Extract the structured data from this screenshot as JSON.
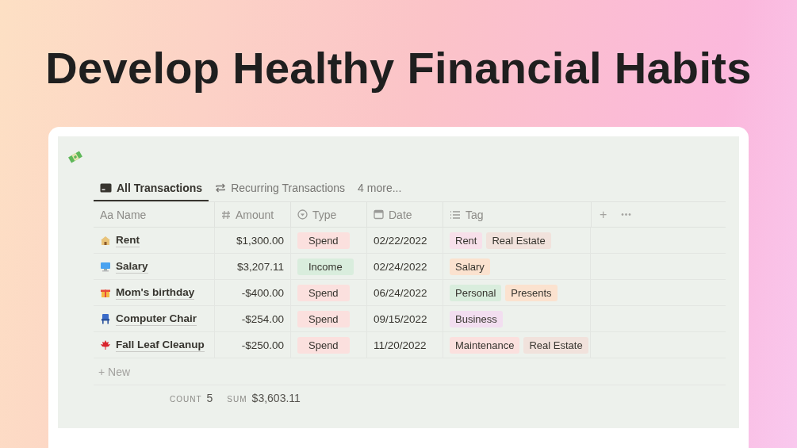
{
  "headline": "Develop Healthy Financial Habits",
  "tabs": [
    {
      "label": "All Transactions",
      "selected": true,
      "kind": "table"
    },
    {
      "label": "Recurring Transactions",
      "selected": false,
      "kind": "repeat"
    },
    {
      "label": "4 more...",
      "selected": false,
      "kind": "more"
    }
  ],
  "table": {
    "columns": [
      {
        "label": "Aa Name",
        "kind": "text"
      },
      {
        "label": "Amount",
        "kind": "number"
      },
      {
        "label": "Type",
        "kind": "select"
      },
      {
        "label": "Date",
        "kind": "date"
      },
      {
        "label": "Tag",
        "kind": "tags"
      }
    ],
    "add_column": "+",
    "more": "•••",
    "rows": [
      {
        "name": "Rent",
        "amount": "$1,300.00",
        "type": {
          "label": "Spend",
          "color": "#fbe0de"
        },
        "date": "02/22/2022",
        "tags": [
          {
            "label": "Rent",
            "color": "#f7e0ea"
          },
          {
            "label": "Real Estate",
            "color": "#f1e2dc"
          }
        ]
      },
      {
        "name": "Salary",
        "amount": "$3,207.11",
        "type": {
          "label": "Income",
          "color": "#d9eddd"
        },
        "date": "02/24/2022",
        "tags": [
          {
            "label": "Salary",
            "color": "#fbe2cf"
          }
        ]
      },
      {
        "name": "Mom's birthday",
        "amount": "-$400.00",
        "type": {
          "label": "Spend",
          "color": "#fbe0de"
        },
        "date": "06/24/2022",
        "tags": [
          {
            "label": "Personal",
            "color": "#d9eddd"
          },
          {
            "label": "Presents",
            "color": "#fbe2cf"
          }
        ]
      },
      {
        "name": "Computer Chair",
        "amount": "-$254.00",
        "type": {
          "label": "Spend",
          "color": "#fbe0de"
        },
        "date": "09/15/2022",
        "tags": [
          {
            "label": "Business",
            "color": "#f2def0"
          }
        ]
      },
      {
        "name": "Fall Leaf Cleanup",
        "amount": "-$250.00",
        "type": {
          "label": "Spend",
          "color": "#fbe0de"
        },
        "date": "11/20/2022",
        "tags": [
          {
            "label": "Maintenance",
            "color": "#fbe0de"
          },
          {
            "label": "Real Estate",
            "color": "#f1e2dc"
          }
        ]
      }
    ],
    "new_row": "+ New",
    "footer": {
      "count_label": "COUNT",
      "count": "5",
      "sum_label": "SUM",
      "sum": "$3,603.11"
    }
  }
}
